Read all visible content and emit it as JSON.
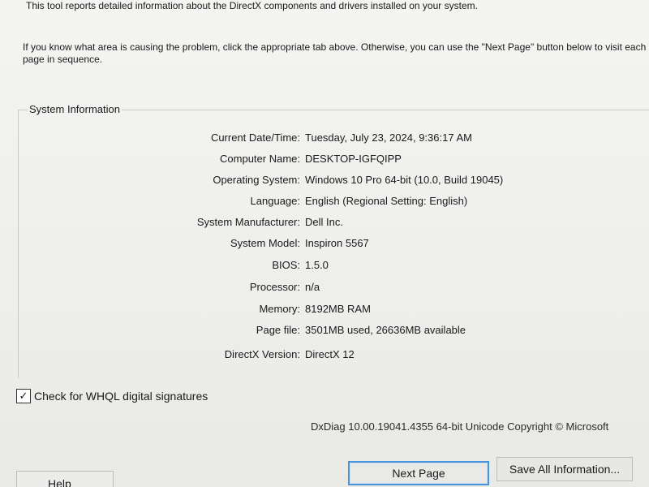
{
  "intro": {
    "line1": "This tool reports detailed information about the DirectX components and drivers installed on your system.",
    "line2": "If you know what area is causing the problem, click the appropriate tab above.  Otherwise, you can use the \"Next Page\" button below to visit each page in sequence."
  },
  "system_info": {
    "title": "System Information",
    "rows": [
      {
        "label": "Current Date/Time:",
        "value": "Tuesday, July 23, 2024, 9:36:17 AM"
      },
      {
        "label": "Computer Name:",
        "value": "DESKTOP-IGFQIPP"
      },
      {
        "label": "Operating System:",
        "value": "Windows 10 Pro 64-bit (10.0, Build 19045)"
      },
      {
        "label": "Language:",
        "value": "English (Regional Setting: English)"
      },
      {
        "label": "System Manufacturer:",
        "value": "Dell Inc."
      },
      {
        "label": "System Model:",
        "value": "Inspiron 5567"
      },
      {
        "label": "BIOS:",
        "value": "1.5.0"
      },
      {
        "label": "Processor:",
        "value": "n/a"
      },
      {
        "label": "Memory:",
        "value": "8192MB RAM"
      },
      {
        "label": "Page file:",
        "value": "3501MB used, 26636MB available"
      },
      {
        "label": "DirectX Version:",
        "value": "DirectX 12"
      }
    ]
  },
  "whql": {
    "label": "Check for WHQL digital signatures",
    "checked": true,
    "check_glyph": "✓"
  },
  "version_text": "DxDiag 10.00.19041.4355 64-bit Unicode  Copyright © Microsoft",
  "buttons": {
    "help": "Help",
    "next_page": "Next Page",
    "save_all": "Save All Information..."
  },
  "colors": {
    "focus_border": "#4b93d9"
  }
}
